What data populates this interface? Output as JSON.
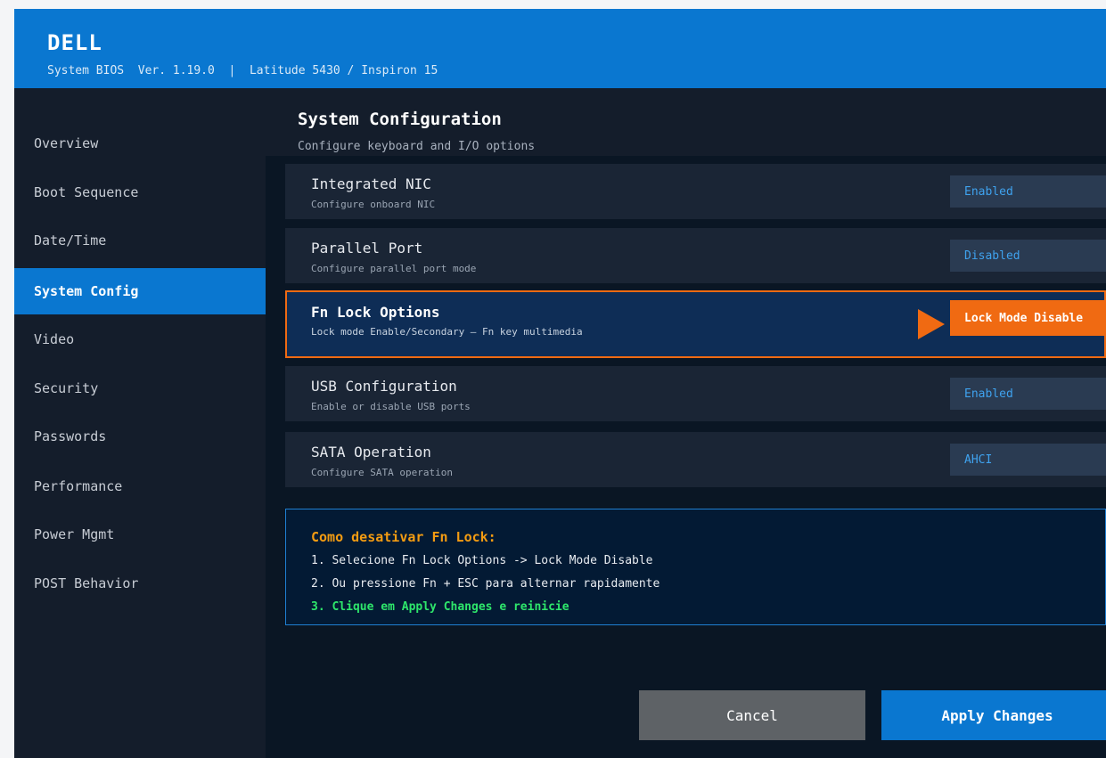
{
  "header": {
    "brand": "DELL",
    "subline": "System BIOS  Ver. 1.19.0  |  Latitude 5430 / Inspiron 15"
  },
  "sidebar": {
    "items": [
      {
        "label": "Overview"
      },
      {
        "label": "Boot Sequence"
      },
      {
        "label": "Date/Time"
      },
      {
        "label": "System Config",
        "active": true
      },
      {
        "label": "Video"
      },
      {
        "label": "Security"
      },
      {
        "label": "Passwords"
      },
      {
        "label": "Performance"
      },
      {
        "label": "Power Mgmt"
      },
      {
        "label": "POST Behavior"
      }
    ]
  },
  "main": {
    "title": "System Configuration",
    "subtitle": "Configure keyboard and I/O options",
    "settings": [
      {
        "name": "Integrated NIC",
        "desc": "Configure onboard NIC",
        "value": "Enabled"
      },
      {
        "name": "Parallel Port",
        "desc": "Configure parallel port mode",
        "value": "Disabled"
      },
      {
        "name": "Fn Lock Options",
        "desc": "Lock mode Enable/Secondary — Fn key multimedia",
        "value": "Lock Mode Disable",
        "selected": true
      },
      {
        "name": "USB Configuration",
        "desc": "Enable or disable USB ports",
        "value": "Enabled"
      },
      {
        "name": "SATA Operation",
        "desc": "Configure SATA operation",
        "value": "AHCI"
      }
    ],
    "help": {
      "title": "Como desativar Fn Lock:",
      "lines": [
        "1. Selecione Fn Lock Options -> Lock Mode Disable",
        "2. Ou pressione Fn + ESC para alternar rapidamente",
        "3. Clique em Apply Changes e reinicie"
      ]
    },
    "buttons": {
      "cancel": "Cancel",
      "apply": "Apply Changes"
    }
  },
  "colors": {
    "accent": "#0a77d0",
    "highlight": "#f06a12",
    "help_title": "#f39c12",
    "help_success": "#2ee66b"
  }
}
